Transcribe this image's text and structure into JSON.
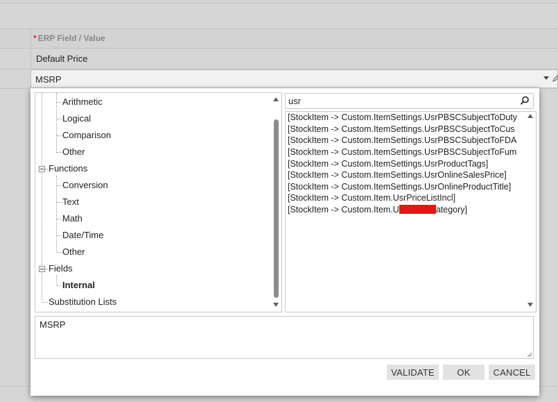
{
  "header": {
    "required_marker": "*",
    "erp_field_label": "ERP Field / Value"
  },
  "row": {
    "default_price": "Default Price"
  },
  "msrp_field": {
    "value": "MSRP",
    "dropdown_icon": "caret-down-icon",
    "edit_icon": "pencil-icon"
  },
  "dialog": {
    "tree": {
      "items": [
        {
          "label": "Arithmetic",
          "level": 2
        },
        {
          "label": "Logical",
          "level": 2
        },
        {
          "label": "Comparison",
          "level": 2
        },
        {
          "label": "Other",
          "level": 2
        },
        {
          "label": "Functions",
          "level": 1,
          "expanded": true
        },
        {
          "label": "Conversion",
          "level": 2
        },
        {
          "label": "Text",
          "level": 2
        },
        {
          "label": "Math",
          "level": 2
        },
        {
          "label": "Date/Time",
          "level": 2
        },
        {
          "label": "Other",
          "level": 2
        },
        {
          "label": "Fields",
          "level": 1,
          "expanded": true
        },
        {
          "label": "Internal",
          "level": 2,
          "bold": true
        },
        {
          "label": "Substitution Lists",
          "level": 1
        }
      ]
    },
    "search": {
      "value": "usr",
      "icon": "search-icon"
    },
    "results": [
      "[StockItem -> Custom.ItemSettings.UsrPBSCSubjectToDuty",
      "[StockItem -> Custom.ItemSettings.UsrPBSCSubjectToCus",
      "[StockItem -> Custom.ItemSettings.UsrPBSCSubjectToFDA",
      "[StockItem -> Custom.ItemSettings.UsrPBSCSubjectToFum",
      "[StockItem -> Custom.ItemSettings.UsrProductTags]",
      "[StockItem -> Custom.ItemSettings.UsrOnlineSalesPrice]",
      "[StockItem -> Custom.ItemSettings.UsrOnlineProductTitle]",
      "[StockItem -> Custom.Item.UsrPriceListIncl]"
    ],
    "last_result": {
      "prefix": "[StockItem -> Custom.Item.U",
      "suffix": "ategory]"
    },
    "expression": "MSRP",
    "buttons": {
      "validate": "VALIDATE",
      "ok": "OK",
      "cancel": "CANCEL"
    }
  }
}
